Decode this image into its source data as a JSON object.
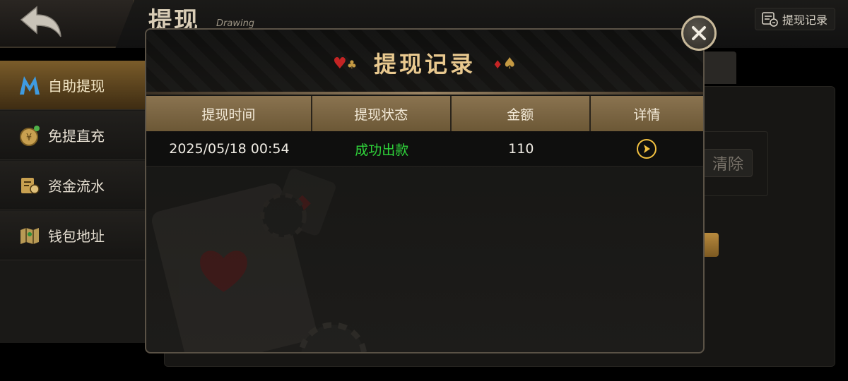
{
  "page": {
    "title": "提现",
    "subtitle": "Drawing",
    "records_button": "提现记录"
  },
  "sidebar": {
    "items": [
      {
        "label": "自助提现",
        "icon": "m-logo-icon",
        "active": true
      },
      {
        "label": "免提直充",
        "icon": "coin-icon",
        "active": false
      },
      {
        "label": "资金流水",
        "icon": "ledger-icon",
        "active": false
      },
      {
        "label": "钱包地址",
        "icon": "map-icon",
        "active": false
      }
    ]
  },
  "background": {
    "clear_button": "清除"
  },
  "modal": {
    "title": "提现记录",
    "columns": [
      "提现时间",
      "提现状态",
      "金额",
      "详情"
    ],
    "rows": [
      {
        "time": "2025/05/18 00:54",
        "status": "成功出款",
        "amount": "110",
        "detail_icon": "arrow-right-circle-icon"
      }
    ],
    "status_color": "#2fd43a",
    "accent_color": "#e9c98f"
  }
}
